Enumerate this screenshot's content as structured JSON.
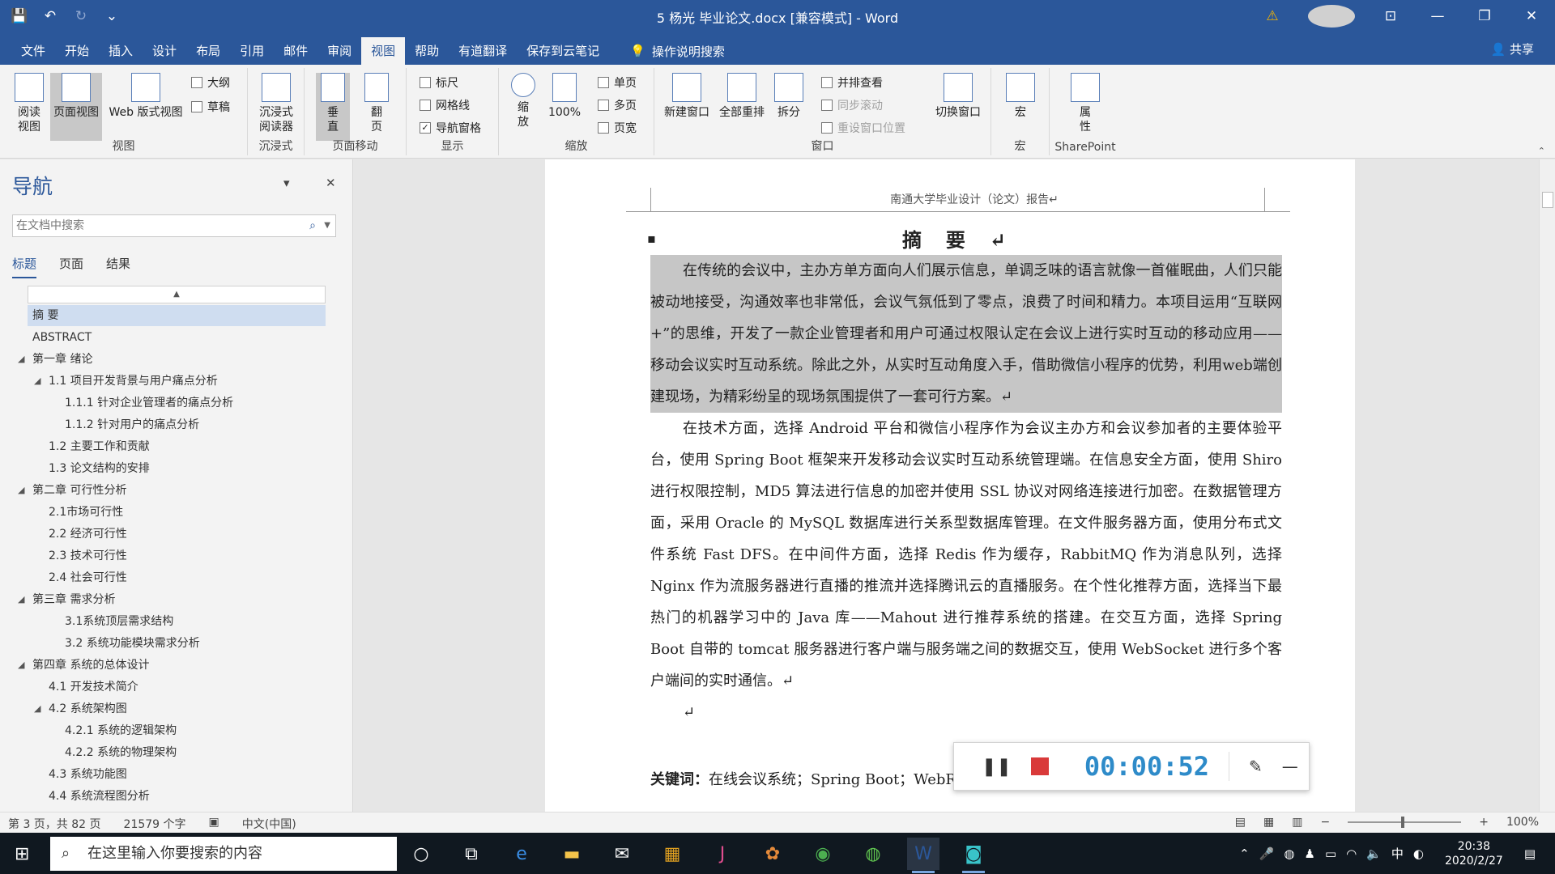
{
  "title": "5 杨光 毕业论文.docx [兼容模式] - Word",
  "qat": {
    "save": "💾",
    "undo": "↶",
    "redo": "↻",
    "more": "⌄"
  },
  "window": {
    "warn": "⚠",
    "ribbon_opts": "⊡",
    "min": "—",
    "max": "❐",
    "close": "✕"
  },
  "tabs": [
    "文件",
    "开始",
    "插入",
    "设计",
    "布局",
    "引用",
    "邮件",
    "审阅",
    "视图",
    "帮助",
    "有道翻译",
    "保存到云笔记"
  ],
  "tell_me": "操作说明搜索",
  "share": "共享",
  "ribbon": {
    "views": {
      "label": "视图",
      "read": "阅读\n视图",
      "print": "页面视图",
      "web": "Web 版式视图",
      "outline": "大纲",
      "draft": "草稿"
    },
    "immersive": {
      "label": "沉浸式",
      "reader": "沉浸式\n阅读器"
    },
    "page_move": {
      "label": "页面移动",
      "vertical": "垂\n直",
      "side": "翻\n页"
    },
    "show": {
      "label": "显示",
      "ruler": "标尺",
      "gridlines": "网格线",
      "nav_pane": "导航窗格"
    },
    "zoom": {
      "label": "缩放",
      "zoom": "缩\n放",
      "pct": "100%",
      "one": "单页",
      "multi": "多页",
      "width": "页宽"
    },
    "window": {
      "label": "窗口",
      "new": "新建窗口",
      "arrange": "全部重排",
      "split": "拆分",
      "side": "并排查看",
      "sync": "同步滚动",
      "reset": "重设窗口位置",
      "switch": "切换窗口"
    },
    "macros": {
      "label": "宏",
      "macro": "宏"
    },
    "sharepoint": {
      "label": "SharePoint",
      "props": "属\n性"
    }
  },
  "nav": {
    "title": "导航",
    "search_placeholder": "在文档中搜索",
    "tabs": [
      "标题",
      "页面",
      "结果"
    ],
    "headings": [
      {
        "text": "摘 要",
        "level": 0,
        "sel": true
      },
      {
        "text": "ABSTRACT",
        "level": 0
      },
      {
        "text": "第一章 绪论",
        "level": 0,
        "tri": true
      },
      {
        "text": "1.1 项目开发背景与用户痛点分析",
        "level": 1,
        "tri": true
      },
      {
        "text": "1.1.1 针对企业管理者的痛点分析",
        "level": 2
      },
      {
        "text": "1.1.2 针对用户的痛点分析",
        "level": 2
      },
      {
        "text": "1.2 主要工作和贡献",
        "level": 1
      },
      {
        "text": "1.3 论文结构的安排",
        "level": 1
      },
      {
        "text": "第二章 可行性分析",
        "level": 0,
        "tri": true
      },
      {
        "text": "2.1市场可行性",
        "level": 1
      },
      {
        "text": "2.2 经济可行性",
        "level": 1
      },
      {
        "text": "2.3 技术可行性",
        "level": 1
      },
      {
        "text": "2.4 社会可行性",
        "level": 1
      },
      {
        "text": "第三章 需求分析",
        "level": 0,
        "tri": true
      },
      {
        "text": "3.1系统顶层需求结构",
        "level": 2
      },
      {
        "text": "3.2 系统功能模块需求分析",
        "level": 2
      },
      {
        "text": "第四章 系统的总体设计",
        "level": 0,
        "tri": true
      },
      {
        "text": "4.1 开发技术简介",
        "level": 1
      },
      {
        "text": "4.2 系统架构图",
        "level": 1,
        "tri": true
      },
      {
        "text": "4.2.1 系统的逻辑架构",
        "level": 2
      },
      {
        "text": "4.2.2 系统的物理架构",
        "level": 2
      },
      {
        "text": "4.3 系统功能图",
        "level": 1
      },
      {
        "text": "4.4 系统流程图分析",
        "level": 1
      }
    ]
  },
  "document": {
    "header": "南通大学毕业设计（论文）报告↵",
    "title": "摘要↵",
    "para1": "在传统的会议中，主办方单方面向人们展示信息，单调乏味的语言就像一首催眠曲，人们只能被动地接受，沟通效率也非常低，会议气氛低到了零点，浪费了时间和精力。本项目运用“互联网+”的思维，开发了一款企业管理者和用户可通过权限认定在会议上进行实时互动的移动应用——移动会议实时互动系统。除此之外，从实时互动角度入手，借助微信小程序的优势，利用web端创建现场，为精彩纷呈的现场氛围提供了一套可行方案。↵",
    "para2": "在技术方面，选择 Android 平台和微信小程序作为会议主办方和会议参加者的主要体验平台，使用 Spring Boot 框架来开发移动会议实时互动系统管理端。在信息安全方面，使用 Shiro 进行权限控制，MD5 算法进行信息的加密并使用 SSL 协议对网络连接进行加密。在数据管理方面，采用 Oracle 的 MySQL 数据库进行关系型数据库管理。在文件服务器方面，使用分布式文件系统 Fast DFS。在中间件方面，选择 Redis 作为缓存，RabbitMQ 作为消息队列，选择 Nginx 作为流服务器进行直播的推流并选择腾讯云的直播服务。在个性化推荐方面，选择当下最热门的机器学习中的 Java 库——Mahout 进行推荐系统的搭建。在交互方面，选择 Spring Boot 自带的 tomcat 服务器进行客户端与服务端之间的数据交互，使用 WebSocket 进行多个客户端间的实时通信。↵",
    "blank": "↵",
    "kw_label": "关键词：",
    "kw_text": "在线会议系统；Spring Boot；WebRTC；Red5；Mahout↵"
  },
  "recorder": {
    "pause": "❚❚",
    "time": "00:00:52",
    "pen": "✎",
    "min": "—"
  },
  "status": {
    "page": "第 3 页，共 82 页",
    "words": "21579 个字",
    "lang": "中文(中国)",
    "zoom": "100%"
  },
  "taskbar": {
    "search": "在这里输入你要搜索的内容",
    "time": "20:38",
    "date": "2020/2/27",
    "ime": "中"
  }
}
